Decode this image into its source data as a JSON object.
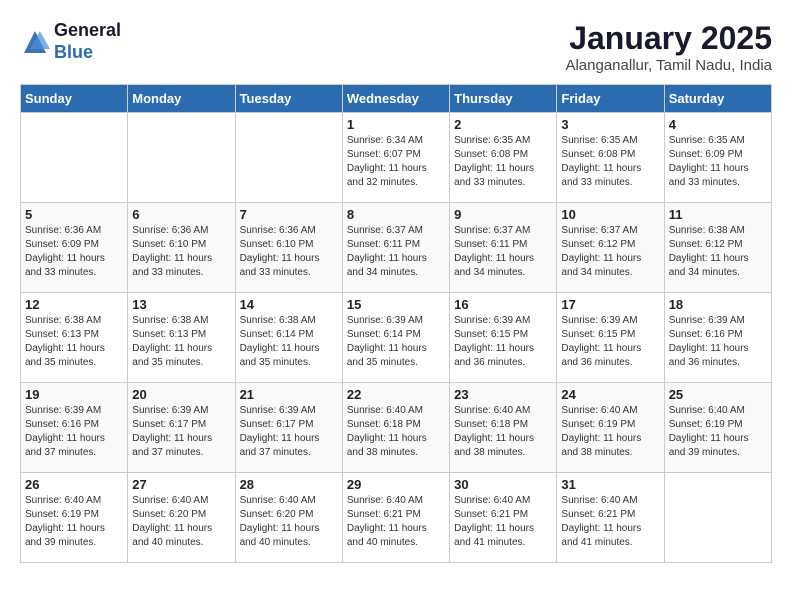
{
  "logo": {
    "general": "General",
    "blue": "Blue"
  },
  "title": "January 2025",
  "location": "Alanganallur, Tamil Nadu, India",
  "days_of_week": [
    "Sunday",
    "Monday",
    "Tuesday",
    "Wednesday",
    "Thursday",
    "Friday",
    "Saturday"
  ],
  "weeks": [
    [
      {
        "day": "",
        "info": ""
      },
      {
        "day": "",
        "info": ""
      },
      {
        "day": "",
        "info": ""
      },
      {
        "day": "1",
        "info": "Sunrise: 6:34 AM\nSunset: 6:07 PM\nDaylight: 11 hours\nand 32 minutes."
      },
      {
        "day": "2",
        "info": "Sunrise: 6:35 AM\nSunset: 6:08 PM\nDaylight: 11 hours\nand 33 minutes."
      },
      {
        "day": "3",
        "info": "Sunrise: 6:35 AM\nSunset: 6:08 PM\nDaylight: 11 hours\nand 33 minutes."
      },
      {
        "day": "4",
        "info": "Sunrise: 6:35 AM\nSunset: 6:09 PM\nDaylight: 11 hours\nand 33 minutes."
      }
    ],
    [
      {
        "day": "5",
        "info": "Sunrise: 6:36 AM\nSunset: 6:09 PM\nDaylight: 11 hours\nand 33 minutes."
      },
      {
        "day": "6",
        "info": "Sunrise: 6:36 AM\nSunset: 6:10 PM\nDaylight: 11 hours\nand 33 minutes."
      },
      {
        "day": "7",
        "info": "Sunrise: 6:36 AM\nSunset: 6:10 PM\nDaylight: 11 hours\nand 33 minutes."
      },
      {
        "day": "8",
        "info": "Sunrise: 6:37 AM\nSunset: 6:11 PM\nDaylight: 11 hours\nand 34 minutes."
      },
      {
        "day": "9",
        "info": "Sunrise: 6:37 AM\nSunset: 6:11 PM\nDaylight: 11 hours\nand 34 minutes."
      },
      {
        "day": "10",
        "info": "Sunrise: 6:37 AM\nSunset: 6:12 PM\nDaylight: 11 hours\nand 34 minutes."
      },
      {
        "day": "11",
        "info": "Sunrise: 6:38 AM\nSunset: 6:12 PM\nDaylight: 11 hours\nand 34 minutes."
      }
    ],
    [
      {
        "day": "12",
        "info": "Sunrise: 6:38 AM\nSunset: 6:13 PM\nDaylight: 11 hours\nand 35 minutes."
      },
      {
        "day": "13",
        "info": "Sunrise: 6:38 AM\nSunset: 6:13 PM\nDaylight: 11 hours\nand 35 minutes."
      },
      {
        "day": "14",
        "info": "Sunrise: 6:38 AM\nSunset: 6:14 PM\nDaylight: 11 hours\nand 35 minutes."
      },
      {
        "day": "15",
        "info": "Sunrise: 6:39 AM\nSunset: 6:14 PM\nDaylight: 11 hours\nand 35 minutes."
      },
      {
        "day": "16",
        "info": "Sunrise: 6:39 AM\nSunset: 6:15 PM\nDaylight: 11 hours\nand 36 minutes."
      },
      {
        "day": "17",
        "info": "Sunrise: 6:39 AM\nSunset: 6:15 PM\nDaylight: 11 hours\nand 36 minutes."
      },
      {
        "day": "18",
        "info": "Sunrise: 6:39 AM\nSunset: 6:16 PM\nDaylight: 11 hours\nand 36 minutes."
      }
    ],
    [
      {
        "day": "19",
        "info": "Sunrise: 6:39 AM\nSunset: 6:16 PM\nDaylight: 11 hours\nand 37 minutes."
      },
      {
        "day": "20",
        "info": "Sunrise: 6:39 AM\nSunset: 6:17 PM\nDaylight: 11 hours\nand 37 minutes."
      },
      {
        "day": "21",
        "info": "Sunrise: 6:39 AM\nSunset: 6:17 PM\nDaylight: 11 hours\nand 37 minutes."
      },
      {
        "day": "22",
        "info": "Sunrise: 6:40 AM\nSunset: 6:18 PM\nDaylight: 11 hours\nand 38 minutes."
      },
      {
        "day": "23",
        "info": "Sunrise: 6:40 AM\nSunset: 6:18 PM\nDaylight: 11 hours\nand 38 minutes."
      },
      {
        "day": "24",
        "info": "Sunrise: 6:40 AM\nSunset: 6:19 PM\nDaylight: 11 hours\nand 38 minutes."
      },
      {
        "day": "25",
        "info": "Sunrise: 6:40 AM\nSunset: 6:19 PM\nDaylight: 11 hours\nand 39 minutes."
      }
    ],
    [
      {
        "day": "26",
        "info": "Sunrise: 6:40 AM\nSunset: 6:19 PM\nDaylight: 11 hours\nand 39 minutes."
      },
      {
        "day": "27",
        "info": "Sunrise: 6:40 AM\nSunset: 6:20 PM\nDaylight: 11 hours\nand 40 minutes."
      },
      {
        "day": "28",
        "info": "Sunrise: 6:40 AM\nSunset: 6:20 PM\nDaylight: 11 hours\nand 40 minutes."
      },
      {
        "day": "29",
        "info": "Sunrise: 6:40 AM\nSunset: 6:21 PM\nDaylight: 11 hours\nand 40 minutes."
      },
      {
        "day": "30",
        "info": "Sunrise: 6:40 AM\nSunset: 6:21 PM\nDaylight: 11 hours\nand 41 minutes."
      },
      {
        "day": "31",
        "info": "Sunrise: 6:40 AM\nSunset: 6:21 PM\nDaylight: 11 hours\nand 41 minutes."
      },
      {
        "day": "",
        "info": ""
      }
    ]
  ]
}
